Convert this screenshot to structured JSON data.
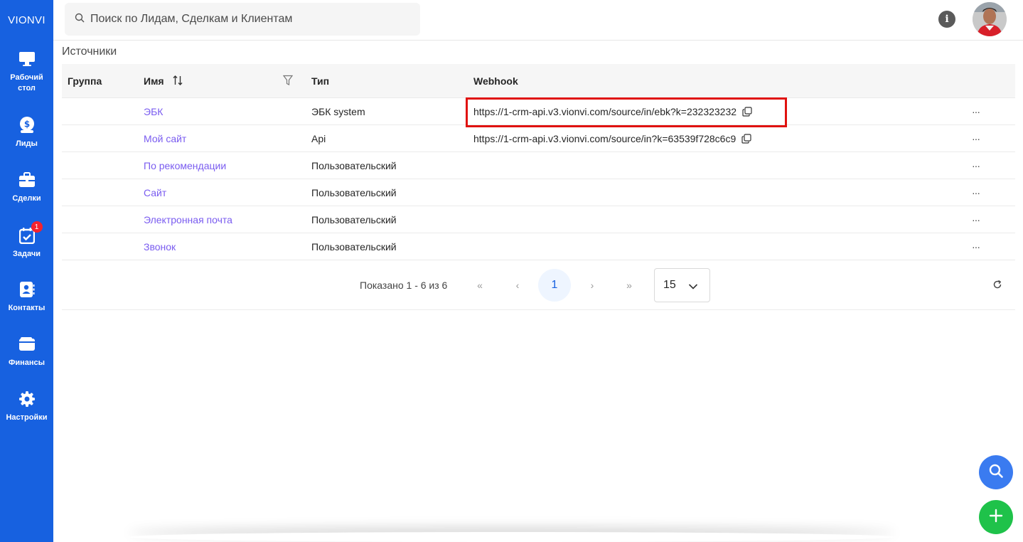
{
  "app": {
    "brand": "VIONVI"
  },
  "sidebar": {
    "items": [
      {
        "label": "Рабочий стол",
        "icon": "monitor-icon"
      },
      {
        "label": "Лиды",
        "icon": "money-bag-icon"
      },
      {
        "label": "Сделки",
        "icon": "briefcase-icon"
      },
      {
        "label": "Задачи",
        "icon": "calendar-check-icon",
        "badge": "1"
      },
      {
        "label": "Контакты",
        "icon": "contact-book-icon"
      },
      {
        "label": "Финансы",
        "icon": "wallet-icon"
      },
      {
        "label": "Настройки",
        "icon": "gear-icon"
      }
    ]
  },
  "header": {
    "search_placeholder": "Поиск по Лидам, Сделкам и Клиентам",
    "info_glyph": "i"
  },
  "page": {
    "title": "Источники"
  },
  "table": {
    "columns": {
      "group": "Группа",
      "name": "Имя",
      "type": "Тип",
      "webhook": "Webhook"
    },
    "rows": [
      {
        "group": "",
        "name": "ЭБК",
        "type": "ЭБК system",
        "webhook": "https://1-crm-api.v3.vionvi.com/source/in/ebk?k=232323232"
      },
      {
        "group": "",
        "name": "Мой сайт",
        "type": "Api",
        "webhook": "https://1-crm-api.v3.vionvi.com/source/in?k=63539f728c6c9"
      },
      {
        "group": "",
        "name": "По рекомендации",
        "type": "Пользовательский",
        "webhook": ""
      },
      {
        "group": "",
        "name": "Сайт",
        "type": "Пользовательский",
        "webhook": ""
      },
      {
        "group": "",
        "name": "Электронная почта",
        "type": "Пользовательский",
        "webhook": ""
      },
      {
        "group": "",
        "name": "Звонок",
        "type": "Пользовательский",
        "webhook": ""
      }
    ],
    "more_glyph": "···"
  },
  "pagination": {
    "shown": "Показано 1 - 6 из 6",
    "first": "«",
    "prev": "‹",
    "current": "1",
    "next": "›",
    "last": "»",
    "page_size": "15"
  },
  "colors": {
    "sidebar": "#1761e0",
    "link": "#7a5cf0",
    "highlight": "#e0120f",
    "fab_search": "#3a7bf0",
    "fab_add": "#1fc24a"
  }
}
